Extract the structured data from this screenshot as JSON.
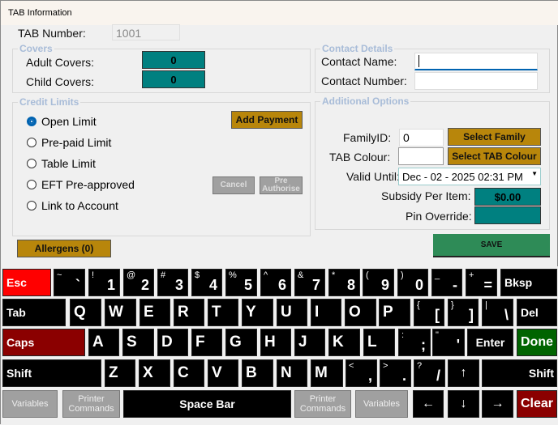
{
  "window": {
    "title": "TAB Information"
  },
  "tab_number": {
    "label": "TAB Number:",
    "value": "1001"
  },
  "covers": {
    "title": "Covers",
    "adult_label": "Adult Covers:",
    "adult_value": "0",
    "child_label": "Child Covers:",
    "child_value": "0"
  },
  "credit": {
    "title": "Credit Limits",
    "options": [
      "Open Limit",
      "Pre-paid Limit",
      "Table Limit",
      "EFT Pre-approved",
      "Link to Account"
    ],
    "selected": 0,
    "add_payment": "Add Payment",
    "cancel": "Cancel",
    "pre_authorise": "Pre Authorise"
  },
  "allergens": "Allergens (0)",
  "contact": {
    "title": "Contact Details",
    "name_label": "Contact Name:",
    "name_value": "",
    "number_label": "Contact Number:",
    "number_value": ""
  },
  "options": {
    "title": "Additional Options",
    "family_label": "FamilyID:",
    "family_value": "0",
    "select_family": "Select Family",
    "colour_label": "TAB Colour:",
    "select_colour": "Select TAB Colour",
    "valid_label": "Valid Until:",
    "valid_value": "Dec - 02 - 2025 02:31 PM",
    "subsidy_label": "Subsidy Per Item:",
    "subsidy_value": "$0.00",
    "pin_label": "Pin Override:",
    "pin_value": ""
  },
  "save": "SAVE",
  "colors": {
    "teal": "#008080",
    "gold": "#b8860b",
    "save": "#2e8b57",
    "esc": "#ff0000",
    "caps": "#8b0000",
    "done": "#006400",
    "clear": "#8b0000",
    "gray": "#a0a0a0"
  },
  "keyboard": {
    "rows": [
      [
        {
          "l": "Esc"
        },
        {
          "s": "~",
          "l": "`"
        },
        {
          "s": "!",
          "l": "1"
        },
        {
          "s": "@",
          "l": "2"
        },
        {
          "s": "#",
          "l": "3"
        },
        {
          "s": "$",
          "l": "4"
        },
        {
          "s": "%",
          "l": "5"
        },
        {
          "s": "^",
          "l": "6"
        },
        {
          "s": "&",
          "l": "7"
        },
        {
          "s": "*",
          "l": "8"
        },
        {
          "s": "(",
          "l": "9"
        },
        {
          "s": ")",
          "l": "0"
        },
        {
          "s": "_",
          "l": "-"
        },
        {
          "s": "+",
          "l": "="
        },
        {
          "l": "Bksp"
        }
      ],
      [
        {
          "l": "Tab"
        },
        {
          "l": "Q"
        },
        {
          "l": "W"
        },
        {
          "l": "E"
        },
        {
          "l": "R"
        },
        {
          "l": "T"
        },
        {
          "l": "Y"
        },
        {
          "l": "U"
        },
        {
          "l": "I"
        },
        {
          "l": "O"
        },
        {
          "l": "P"
        },
        {
          "s": "{",
          "l": "["
        },
        {
          "s": "}",
          "l": "]"
        },
        {
          "s": "|",
          "l": "\\"
        },
        {
          "l": "Del"
        }
      ],
      [
        {
          "l": "Caps"
        },
        {
          "l": "A"
        },
        {
          "l": "S"
        },
        {
          "l": "D"
        },
        {
          "l": "F"
        },
        {
          "l": "G"
        },
        {
          "l": "H"
        },
        {
          "l": "J"
        },
        {
          "l": "K"
        },
        {
          "l": "L"
        },
        {
          "s": ":",
          "l": ";"
        },
        {
          "s": "\"",
          "l": "'"
        },
        {
          "l": "Enter"
        },
        {
          "l": "Done"
        }
      ],
      [
        {
          "l": "Shift"
        },
        {
          "l": "Z"
        },
        {
          "l": "X"
        },
        {
          "l": "C"
        },
        {
          "l": "V"
        },
        {
          "l": "B"
        },
        {
          "l": "N"
        },
        {
          "l": "M"
        },
        {
          "s": "<",
          "l": ","
        },
        {
          "s": ">",
          "l": "."
        },
        {
          "s": "?",
          "l": "/"
        },
        {
          "l": "↑"
        },
        {
          "l": "Shift"
        }
      ],
      [
        {
          "l": "Variables"
        },
        {
          "l": "Printer Commands"
        },
        {
          "l": "Space Bar"
        },
        {
          "l": "Printer Commands"
        },
        {
          "l": "Variables"
        },
        {
          "l": "←"
        },
        {
          "l": "↓"
        },
        {
          "l": "→"
        },
        {
          "l": "Clear"
        }
      ]
    ]
  }
}
